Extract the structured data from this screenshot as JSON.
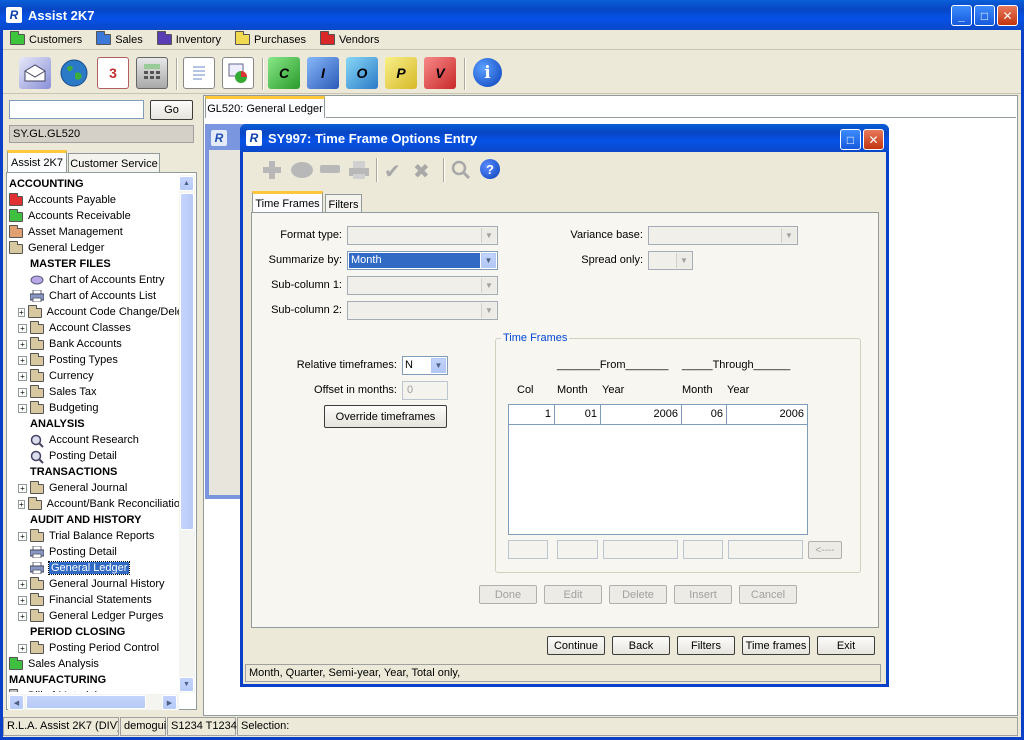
{
  "app": {
    "title": "Assist 2K7"
  },
  "menu": {
    "items": [
      {
        "label": "Customers",
        "color": "#3cc43c"
      },
      {
        "label": "Sales",
        "color": "#3c78d8"
      },
      {
        "label": "Inventory",
        "color": "#5a3cb4"
      },
      {
        "label": "Purchases",
        "color": "#f0d850"
      },
      {
        "label": "Vendors",
        "color": "#d82828"
      }
    ]
  },
  "toolbar": {
    "letters": [
      "C",
      "I",
      "O",
      "P",
      "V"
    ],
    "day": "3"
  },
  "sidebar": {
    "search_value": "",
    "go_label": "Go",
    "path": "SY.GL.GL520",
    "tabs": [
      "Assist 2K7",
      "Customer Service"
    ],
    "tree": [
      {
        "label": "ACCOUNTING",
        "kind": "header",
        "indent": 0
      },
      {
        "label": "Accounts Payable",
        "kind": "folder",
        "color": "#e03030",
        "indent": 0
      },
      {
        "label": "Accounts Receivable",
        "kind": "folder",
        "color": "#40c040",
        "indent": 0
      },
      {
        "label": "Asset Management",
        "kind": "folder",
        "color": "#e0a070",
        "indent": 0
      },
      {
        "label": "General Ledger",
        "kind": "folder",
        "color": "#d8c8a0",
        "indent": 0
      },
      {
        "label": "MASTER FILES",
        "kind": "subheader",
        "indent": 1
      },
      {
        "label": "Chart of Accounts Entry",
        "kind": "entry",
        "indent": 1
      },
      {
        "label": "Chart of Accounts List",
        "kind": "printer",
        "indent": 1
      },
      {
        "label": "Account Code Change/Dele",
        "kind": "folder-plus",
        "indent": 1
      },
      {
        "label": "Account Classes",
        "kind": "folder-plus",
        "indent": 1
      },
      {
        "label": "Bank Accounts",
        "kind": "folder-plus",
        "indent": 1
      },
      {
        "label": "Posting Types",
        "kind": "folder-plus",
        "indent": 1
      },
      {
        "label": "Currency",
        "kind": "folder-plus",
        "indent": 1
      },
      {
        "label": "Sales Tax",
        "kind": "folder-plus",
        "indent": 1
      },
      {
        "label": "Budgeting",
        "kind": "folder-plus",
        "indent": 1
      },
      {
        "label": "ANALYSIS",
        "kind": "subheader",
        "indent": 1
      },
      {
        "label": "Account Research",
        "kind": "search",
        "indent": 1
      },
      {
        "label": "Posting Detail",
        "kind": "search",
        "indent": 1
      },
      {
        "label": "TRANSACTIONS",
        "kind": "subheader",
        "indent": 1
      },
      {
        "label": "General Journal",
        "kind": "folder-plus",
        "indent": 1
      },
      {
        "label": "Account/Bank Reconciliatio",
        "kind": "folder-plus",
        "indent": 1
      },
      {
        "label": "AUDIT AND HISTORY",
        "kind": "subheader",
        "indent": 1
      },
      {
        "label": "Trial Balance Reports",
        "kind": "folder-plus",
        "indent": 1
      },
      {
        "label": "Posting Detail",
        "kind": "printer",
        "indent": 1
      },
      {
        "label": "General Ledger",
        "kind": "printer",
        "indent": 1,
        "selected": true
      },
      {
        "label": "General Journal History",
        "kind": "folder-plus",
        "indent": 1
      },
      {
        "label": "Financial Statements",
        "kind": "folder-plus",
        "indent": 1
      },
      {
        "label": "General Ledger Purges",
        "kind": "folder-plus",
        "indent": 1
      },
      {
        "label": "PERIOD CLOSING",
        "kind": "subheader",
        "indent": 1
      },
      {
        "label": "Posting Period Control",
        "kind": "folder-plus",
        "indent": 1
      },
      {
        "label": "Sales Analysis",
        "kind": "folder",
        "color": "#40c040",
        "indent": 0
      },
      {
        "label": "MANUFACTURING",
        "kind": "header",
        "indent": 0
      },
      {
        "label": "Bill of Materials",
        "kind": "folder",
        "color": "#c0c0c0",
        "indent": 0
      }
    ]
  },
  "doc_tab": "GL520: General Ledger",
  "dialog": {
    "title": "SY997: Time Frame Options Entry",
    "tabs": [
      "Time Frames",
      "Filters"
    ],
    "fields": {
      "format_type_label": "Format type:",
      "summarize_by_label": "Summarize by:",
      "summarize_by_value": "Month",
      "sub_column1_label": "Sub-column 1:",
      "sub_column2_label": "Sub-column 2:",
      "variance_base_label": "Variance base:",
      "spread_only_label": "Spread only:",
      "relative_label": "Relative timeframes:",
      "relative_value": "N",
      "offset_label": "Offset in months:",
      "offset_value": "0",
      "override_label": "Override timeframes"
    },
    "timeframes": {
      "title": "Time Frames",
      "from_header": "_______From_______",
      "through_header": "_____Through______",
      "col_headers": [
        "Col",
        "Month",
        "Year",
        "Month",
        "Year"
      ],
      "rows": [
        {
          "col": "1",
          "from_month": "01",
          "from_year": "2006",
          "through_month": "06",
          "through_year": "2006"
        }
      ],
      "arrow_label": "<----"
    },
    "row_buttons": [
      "Done",
      "Edit",
      "Delete",
      "Insert",
      "Cancel"
    ],
    "footer_buttons": [
      "Continue",
      "Back",
      "Filters",
      "Time frames",
      "Exit"
    ],
    "status": "Month,  Quarter,  Semi-year,  Year,  Total only,"
  },
  "statusbar": {
    "segments": [
      "R.L.A. Assist 2K7 (DIV)",
      "demogui",
      "S1234 T1234",
      "Selection:"
    ]
  }
}
